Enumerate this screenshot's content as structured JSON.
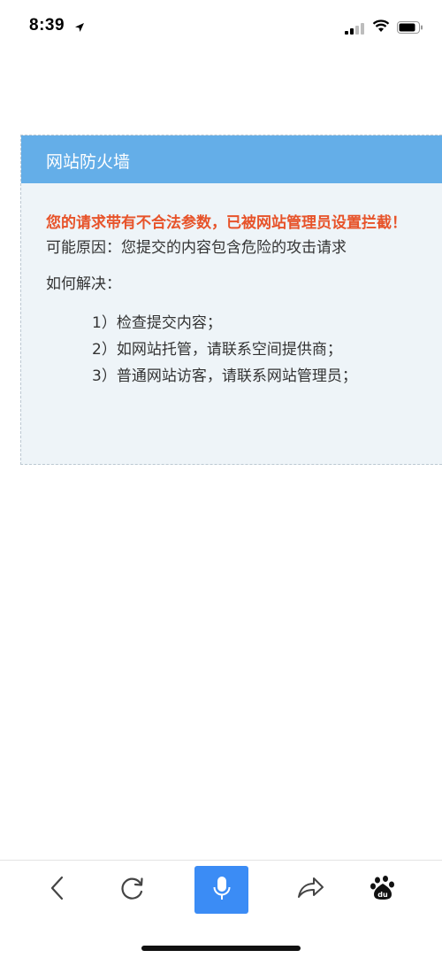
{
  "status_bar": {
    "time": "8:39",
    "icons": [
      "location-arrow-icon",
      "signal-icon",
      "wifi-icon",
      "battery-icon"
    ]
  },
  "firewall": {
    "title": "网站防火墙",
    "alert": "您的请求带有不合法参数，已被网站管理员设置拦截！",
    "reason": "可能原因：您提交的内容包含危险的攻击请求",
    "how_label": "如何解决：",
    "steps": [
      "1）检查提交内容；",
      "2）如网站托管，请联系空间提供商；",
      "3）普通网站访客，请联系网站管理员；"
    ]
  },
  "toolbar": {
    "icons": [
      "back-icon",
      "refresh-icon",
      "microphone-icon",
      "share-icon",
      "baidu-paw-icon"
    ],
    "baidu_logo_text": "du"
  },
  "colors": {
    "header": "#64aee8",
    "panel_bg": "#eef4f8",
    "alert": "#e7532a",
    "voice_button": "#3b8cf5"
  }
}
